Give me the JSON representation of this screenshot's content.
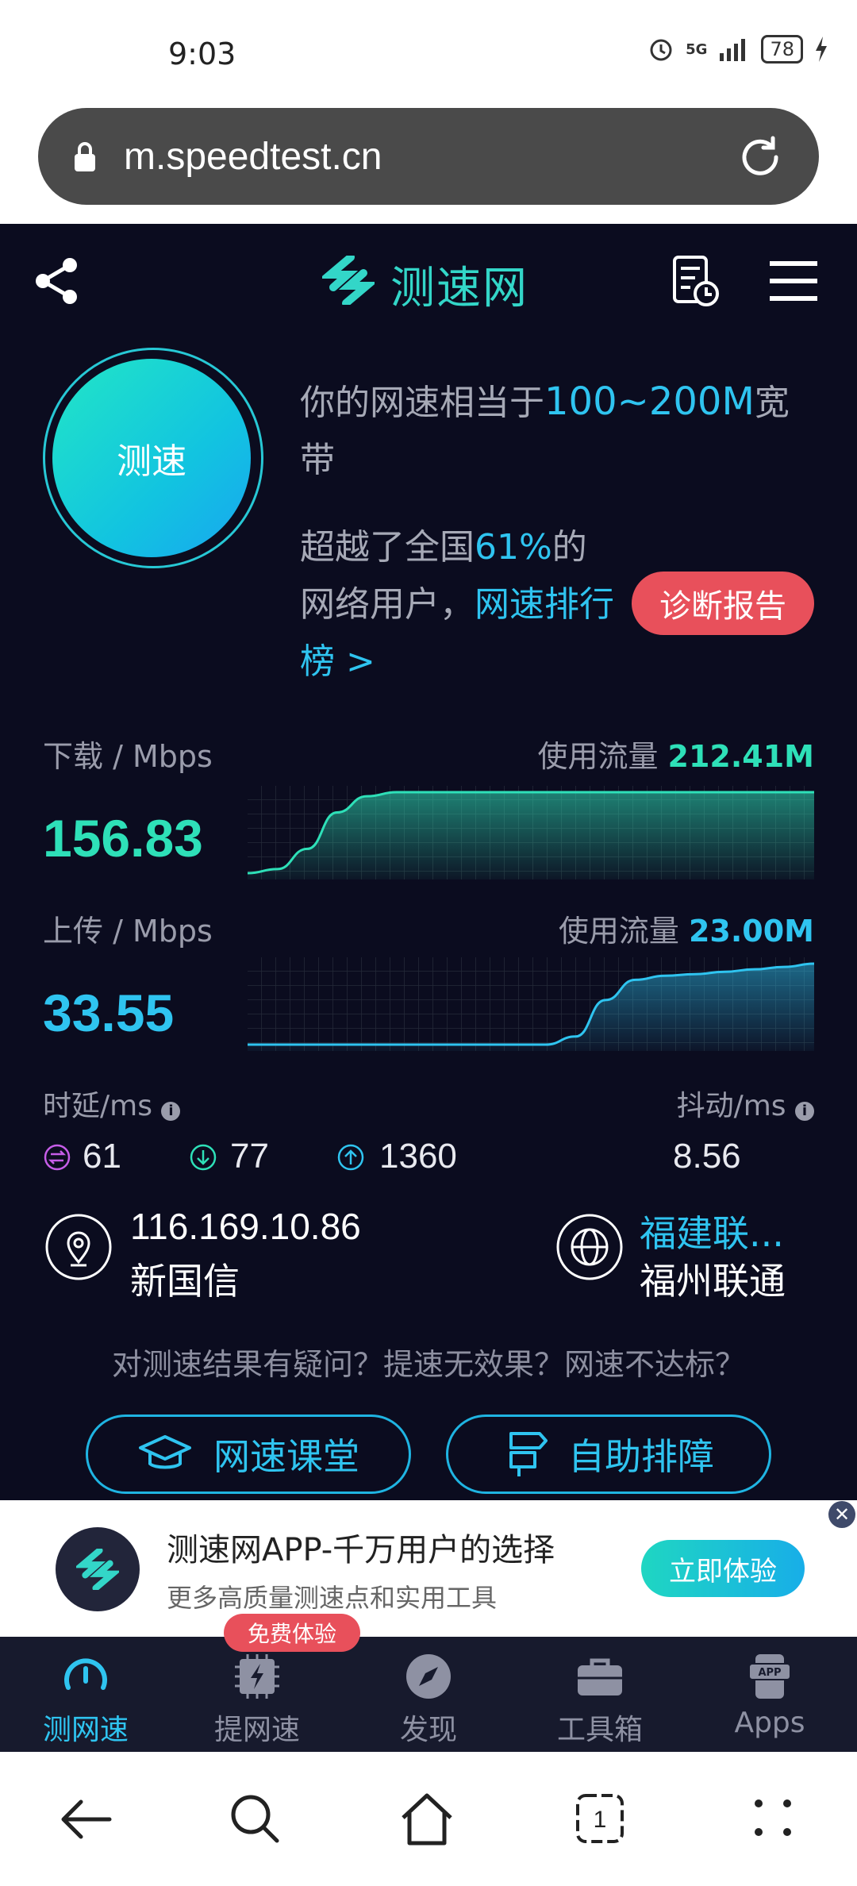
{
  "status_bar": {
    "time": "9:03",
    "battery": "78",
    "network": "5G"
  },
  "browser": {
    "url": "m.speedtest.cn"
  },
  "header": {
    "logo_text": "测速网"
  },
  "speed_button": {
    "label": "测速"
  },
  "summary": {
    "line1_prefix": "你的网速相当于",
    "line1_highlight": "100~200M",
    "line1_suffix": "宽带",
    "line2_prefix": "超越了全国",
    "line2_highlight": "61%",
    "line2_suffix": "的",
    "line3_prefix": "网络用户，",
    "line3_link": "网速排行榜 >",
    "diagnose_button": "诊断报告"
  },
  "download": {
    "label": "下载 / Mbps",
    "value": "156.83",
    "usage_label": "使用流量",
    "usage_value": "212.41M"
  },
  "upload": {
    "label": "上传 / Mbps",
    "value": "33.55",
    "usage_label": "使用流量",
    "usage_value": "23.00M"
  },
  "latency": {
    "label": "时延/ms",
    "idle": "61",
    "down": "77",
    "up": "1360"
  },
  "jitter": {
    "label": "抖动/ms",
    "value": "8.56"
  },
  "server": {
    "ip": "116.169.10.86",
    "isp": "新国信"
  },
  "node": {
    "region": "福建联...",
    "city": "福州联通"
  },
  "question": "对测速结果有疑问？提速无效果？网速不达标？",
  "actions": {
    "classroom": "网速课堂",
    "troubleshoot": "自助排障"
  },
  "banner": {
    "title": "测速网APP-千万用户的选择",
    "subtitle": "更多高质量测速点和实用工具",
    "button": "立即体验"
  },
  "free_badge": "免费体验",
  "tabs": [
    {
      "label": "测网速"
    },
    {
      "label": "提网速"
    },
    {
      "label": "发现"
    },
    {
      "label": "工具箱"
    },
    {
      "label": "Apps"
    }
  ],
  "colors": {
    "accent": "#2fc4f0",
    "download": "#2ee0b8",
    "upload": "#2fc4f0",
    "alert": "#e8505b",
    "background": "#0b0c1f"
  },
  "chart_data": [
    {
      "type": "area",
      "series": [
        {
          "name": "下载",
          "values": [
            0,
            0.05,
            0.3,
            0.75,
            0.95,
            1,
            1,
            1,
            1,
            1,
            1,
            1,
            1,
            1,
            1,
            1,
            1,
            1,
            1,
            1
          ]
        }
      ]
    },
    {
      "type": "area",
      "series": [
        {
          "name": "上传",
          "values": [
            0,
            0,
            0,
            0,
            0,
            0,
            0,
            0,
            0,
            0,
            0,
            0.1,
            0.55,
            0.8,
            0.85,
            0.87,
            0.9,
            0.93,
            0.96,
            1
          ]
        }
      ]
    }
  ]
}
